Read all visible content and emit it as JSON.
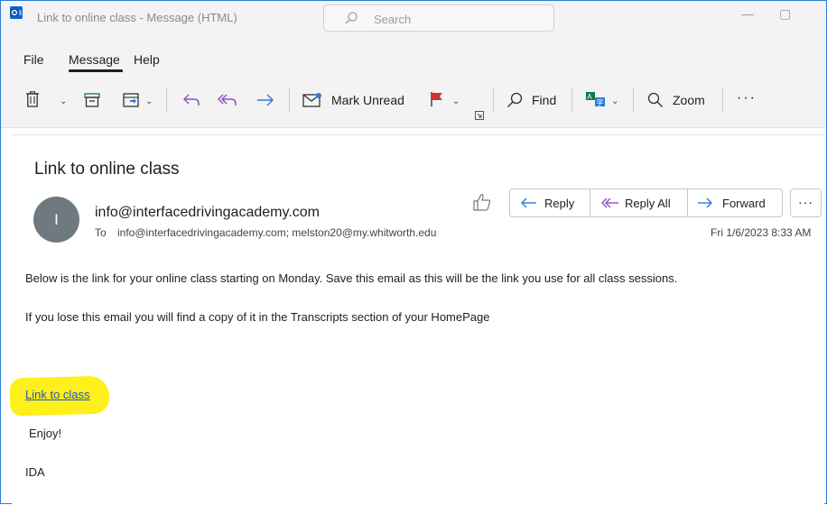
{
  "window": {
    "title": "Link to online class  -  Message (HTML)",
    "search_placeholder": "Search",
    "minimize": "—",
    "maximize": "▢"
  },
  "menu": {
    "items": [
      "File",
      "Message",
      "Help"
    ],
    "active": "Message"
  },
  "toolbar": {
    "mark_unread": "Mark Unread",
    "find": "Find",
    "zoom": "Zoom",
    "more": "···"
  },
  "message": {
    "subject": "Link to online class",
    "avatar_initial": "I",
    "sender": "info@interfacedrivingacademy.com",
    "to_label": "To",
    "to_value": "info@interfacedrivingacademy.com; melston20@my.whitworth.edu",
    "date": "Fri 1/6/2023 8:33 AM",
    "actions": {
      "reply": "Reply",
      "reply_all": "Reply All",
      "forward": "Forward",
      "more": "···"
    },
    "body": {
      "line1": "Below is the link for your online class starting on Monday. Save this email as this will be the link you use for all class sessions.",
      "line2": "If you lose this email you will find a copy of it in the Transcripts section of your HomePage",
      "link": "Link to class",
      "enjoy": "Enjoy!",
      "signature": "IDA"
    }
  },
  "colors": {
    "accent": "#2d7ad6",
    "highlight": "#ffef1a",
    "link": "#1a56c6",
    "flag": "#d13438",
    "archive": "#107c41"
  }
}
